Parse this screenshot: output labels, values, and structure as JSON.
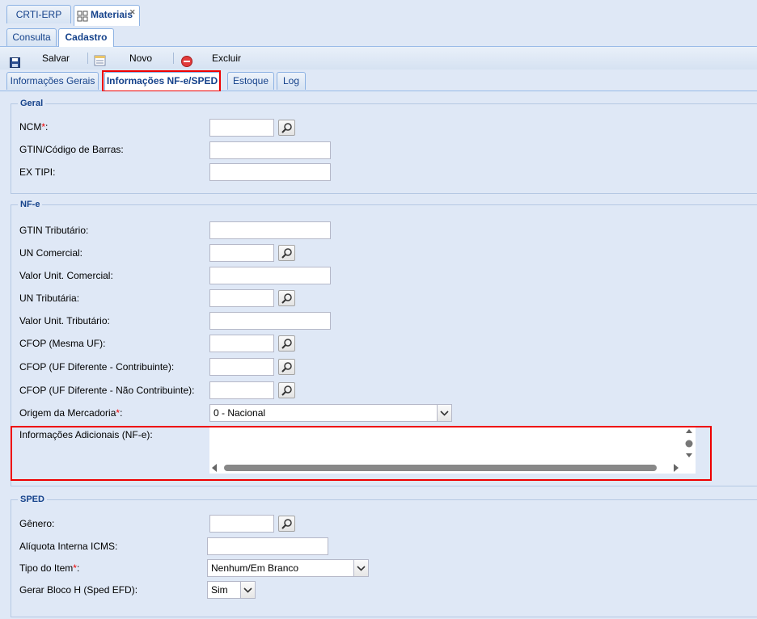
{
  "app_tabs": [
    {
      "label": "CRTI-ERP"
    },
    {
      "label": "Materiais",
      "close": "✕"
    }
  ],
  "sub_tabs": [
    {
      "label": "Consulta"
    },
    {
      "label": "Cadastro"
    }
  ],
  "toolbar": {
    "save_label": "Salvar",
    "new_label": "Novo",
    "delete_label": "Excluir"
  },
  "form_tabs": [
    {
      "label": "Informações Gerais"
    },
    {
      "label": "Informações NF-e/SPED"
    },
    {
      "label": "Estoque"
    },
    {
      "label": "Log"
    }
  ],
  "geral": {
    "legend": "Geral",
    "ncm_label": "NCM",
    "gtin_label": "GTIN/Código de Barras:",
    "extipi_label": "EX TIPI:"
  },
  "nfe": {
    "legend": "NF-e",
    "gtin_trib_label": "GTIN Tributário:",
    "un_com_label": "UN Comercial:",
    "valor_com_label": "Valor Unit. Comercial:",
    "un_trib_label": "UN Tributária:",
    "valor_trib_label": "Valor Unit. Tributário:",
    "cfop_mesma_label": "CFOP (Mesma UF):",
    "cfop_dif_contrib_label": "CFOP (UF Diferente - Contribuinte):",
    "cfop_dif_nao_label": "CFOP (UF Diferente - Não Contribuinte):",
    "origem_label": "Origem da Mercadoria",
    "origem_value": "0 - Nacional",
    "info_adic_label": "Informações Adicionais (NF-e):"
  },
  "sped": {
    "legend": "SPED",
    "genero_label": "Gênero:",
    "aliquota_label": "Alíquota Interna ICMS:",
    "tipo_item_label": "Tipo do Item",
    "tipo_item_value": "Nenhum/Em Branco",
    "bloco_h_label": "Gerar Bloco H (Sped EFD):",
    "bloco_h_value": "Sim"
  },
  "required_mark": "*",
  "label_colon": ":",
  "colors": {
    "accent": "#15428b",
    "highlight": "#e00000",
    "required": "#e00000"
  }
}
